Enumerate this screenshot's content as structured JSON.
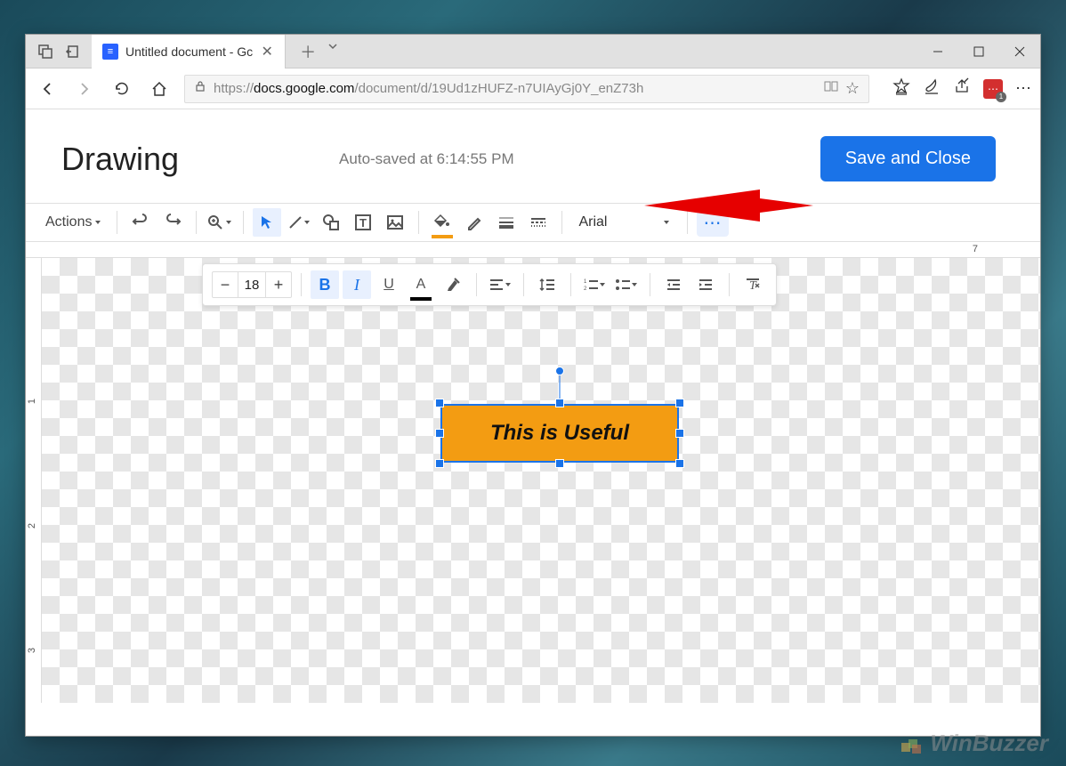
{
  "browser": {
    "tab_title": "Untitled document - Gc",
    "url_proto": "https://",
    "url_domain": "docs.google.com",
    "url_path": "/document/d/19Ud1zHUFZ-n7UIAyGj0Y_enZ73h",
    "ext_badge": "1"
  },
  "dialog": {
    "title": "Drawing",
    "autosave": "Auto-saved at 6:14:55 PM",
    "save_close_label": "Save and Close"
  },
  "toolbar": {
    "actions_label": "Actions",
    "font_name": "Arial",
    "font_size": "18",
    "more": "⋯"
  },
  "textbox": {
    "text": "This is Useful"
  },
  "ruler_h": {
    "tick7": "7"
  },
  "ruler_v": {
    "tick1": "1",
    "tick2": "2",
    "tick3": "3"
  },
  "watermark": "WinBuzzer"
}
